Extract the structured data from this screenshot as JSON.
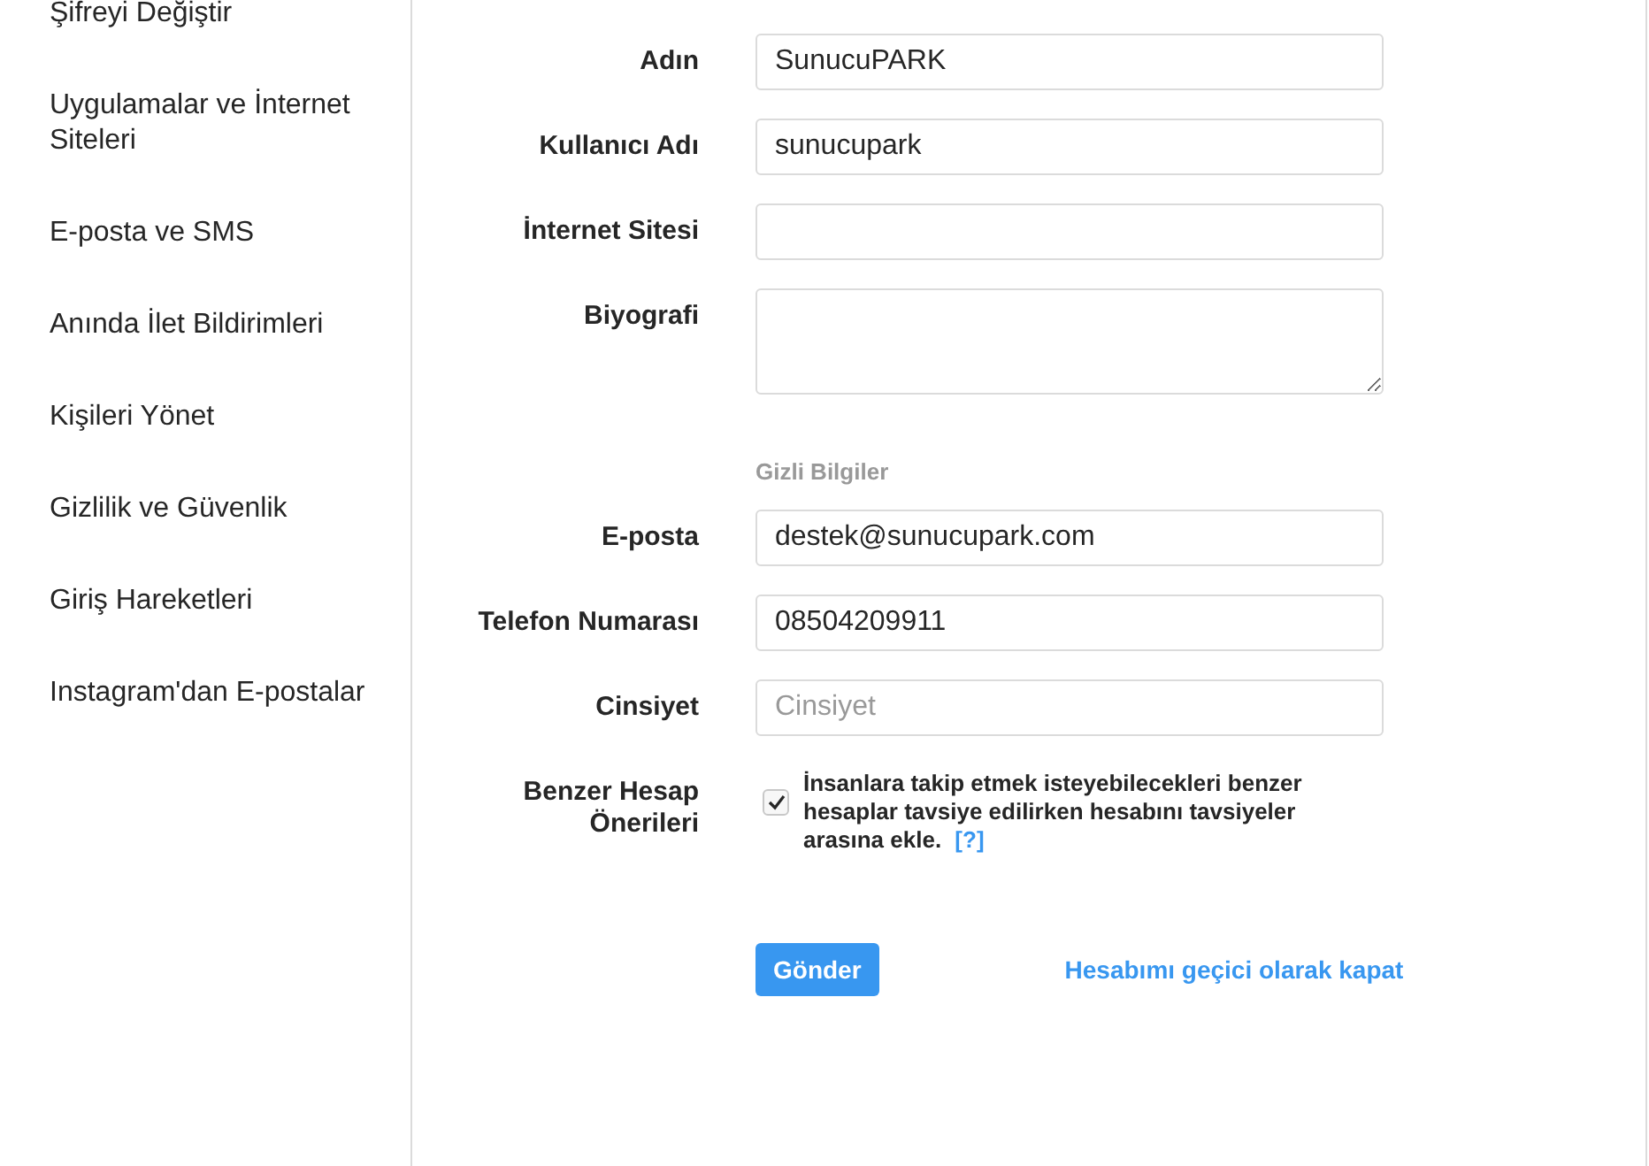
{
  "sidebar": {
    "items": [
      {
        "label": "Şifreyi Değiştir"
      },
      {
        "label": "Uygulamalar ve İnternet Siteleri"
      },
      {
        "label": "E-posta ve SMS"
      },
      {
        "label": "Anında İlet Bildirimleri"
      },
      {
        "label": "Kişileri Yönet"
      },
      {
        "label": "Gizlilik ve Güvenlik"
      },
      {
        "label": "Giriş Hareketleri"
      },
      {
        "label": "Instagram'dan E-postalar"
      }
    ]
  },
  "form": {
    "fields": [
      {
        "kind": "input",
        "label": "Adın",
        "value": "SunucuPARK"
      },
      {
        "kind": "input",
        "label": "Kullanıcı Adı",
        "value": "sunucupark"
      },
      {
        "kind": "input",
        "label": "İnternet Sitesi"
      },
      {
        "kind": "textarea",
        "label": "Biyografi"
      },
      {
        "kind": "section",
        "label": "Gizli Bilgiler"
      },
      {
        "kind": "input",
        "label": "E-posta",
        "value": "destek@sunucupark.com"
      },
      {
        "kind": "input",
        "label": "Telefon Numarası",
        "value": "08504209911"
      },
      {
        "kind": "input",
        "label": "Cinsiyet",
        "placeholder": "Cinsiyet"
      }
    ],
    "similar_accounts": {
      "label": "Benzer Hesap Önerileri",
      "checked": true,
      "text": "İnsanlara takip etmek isteyebilecekleri benzer hesaplar tavsiye edilirken hesabını tavsiyeler arasına ekle.",
      "help_link": "[?]"
    },
    "submit_button": "Gönder",
    "disable_link": "Hesabımı geçici olarak kapat"
  }
}
